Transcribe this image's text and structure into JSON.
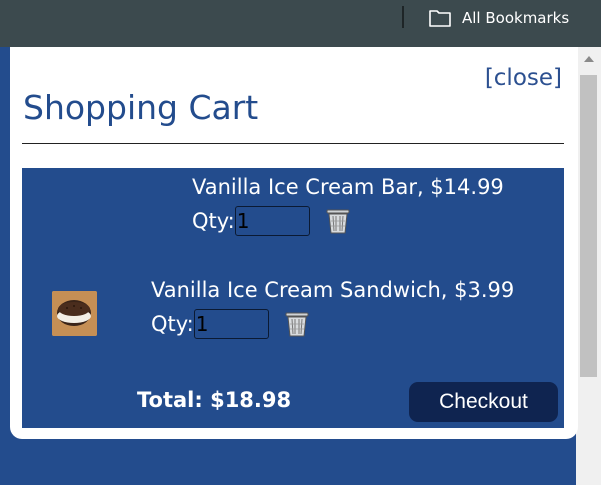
{
  "browser": {
    "bookmarks_label": "All Bookmarks"
  },
  "modal": {
    "close_label": "[close]",
    "title": "Shopping Cart"
  },
  "cart": {
    "items": [
      {
        "name": "Vanilla Ice Cream Bar, $14.99",
        "qty_label": "Qty:",
        "qty_value": "1"
      },
      {
        "name": "Vanilla Ice Cream Sandwich, $3.99",
        "qty_label": "Qty:",
        "qty_value": "1",
        "image": "ice-cream-sandwich"
      }
    ],
    "total": "Total: $18.98",
    "checkout_label": "Checkout"
  },
  "colors": {
    "brand_blue": "#234c8d",
    "checkout_bg": "#0f2450",
    "browser_bar": "#3c4a4e"
  },
  "icons": [
    "folder-icon",
    "trash-icon",
    "scroll-up-arrow-icon"
  ]
}
